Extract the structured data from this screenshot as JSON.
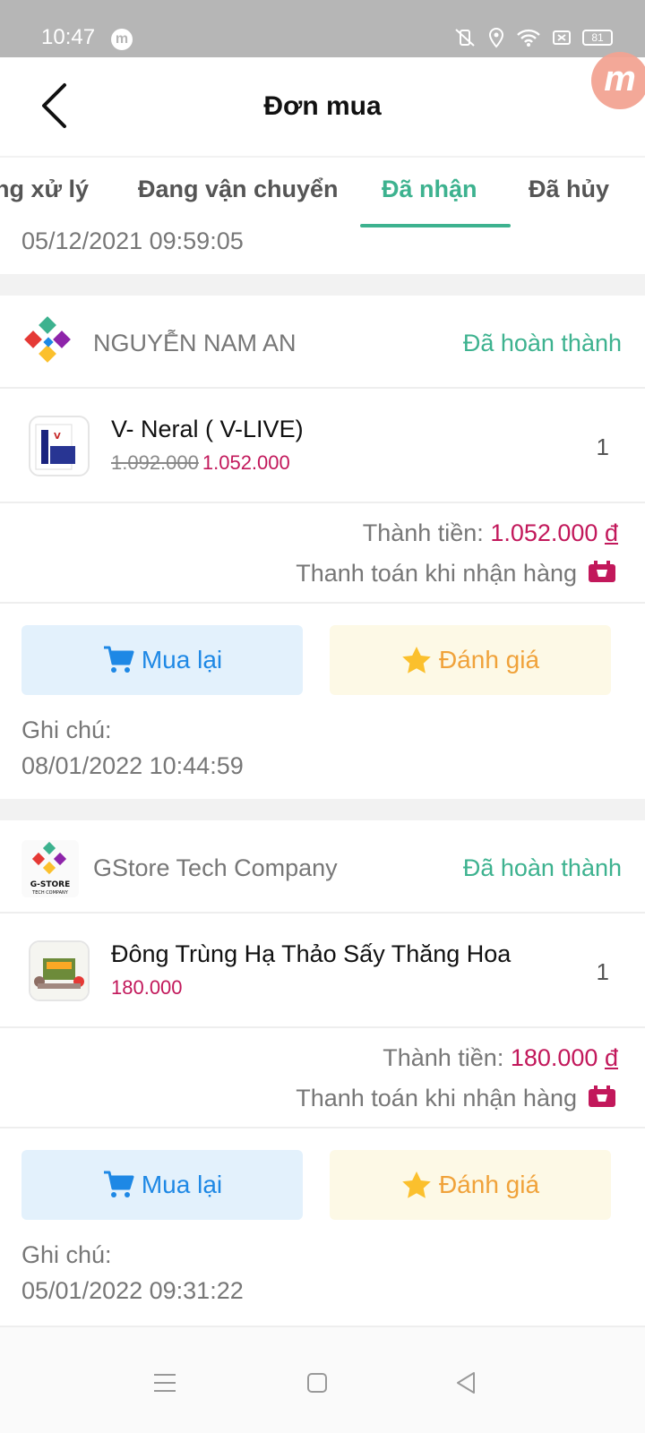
{
  "status_bar": {
    "time": "10:47",
    "battery": "81",
    "app_icon": "m"
  },
  "header": {
    "title": "Đơn mua",
    "float_logo": "m"
  },
  "tabs": [
    {
      "label": "ng xử lý",
      "active": false
    },
    {
      "label": "Đang vận chuyển",
      "active": false
    },
    {
      "label": "Đã nhận",
      "active": true
    },
    {
      "label": "Đã hủy",
      "active": false
    }
  ],
  "previous_order": {
    "date": "05/12/2021 09:59:05"
  },
  "orders": [
    {
      "shop": {
        "name": "NGUYỄN NAM AN",
        "logo_icon": "colorful-diamond-logo"
      },
      "status": "Đã hoàn thành",
      "product": {
        "name": "V- Neral ( V-LIVE)",
        "old_price": "1.092.000",
        "price": "1.052.000",
        "qty": "1"
      },
      "total_label": "Thành tiền:",
      "total_value": "1.052.000",
      "currency": "đ",
      "payment": "Thanh toán khi nhận hàng",
      "rebuy_label": "Mua lại",
      "review_label": "Đánh giá",
      "note_label": "Ghi chú:",
      "date": "08/01/2022 10:44:59"
    },
    {
      "shop": {
        "name": "GStore Tech Company",
        "logo_icon": "gstore-logo",
        "logo_text": "G-STORE",
        "logo_subtext": "TECH COMPANY"
      },
      "status": "Đã hoàn thành",
      "product": {
        "name": "Đông Trùng Hạ Thảo Sấy Thăng Hoa",
        "old_price": "",
        "price": "180.000",
        "qty": "1"
      },
      "total_label": "Thành tiền:",
      "total_value": "180.000",
      "currency": "đ",
      "payment": "Thanh toán khi nhận hàng",
      "rebuy_label": "Mua lại",
      "review_label": "Đánh giá",
      "note_label": "Ghi chú:",
      "date": "05/01/2022 09:31:22"
    }
  ],
  "colors": {
    "accent": "#3db28f",
    "price": "#c2185b",
    "rebuy": "#1e88e5",
    "review": "#f0a23a"
  }
}
